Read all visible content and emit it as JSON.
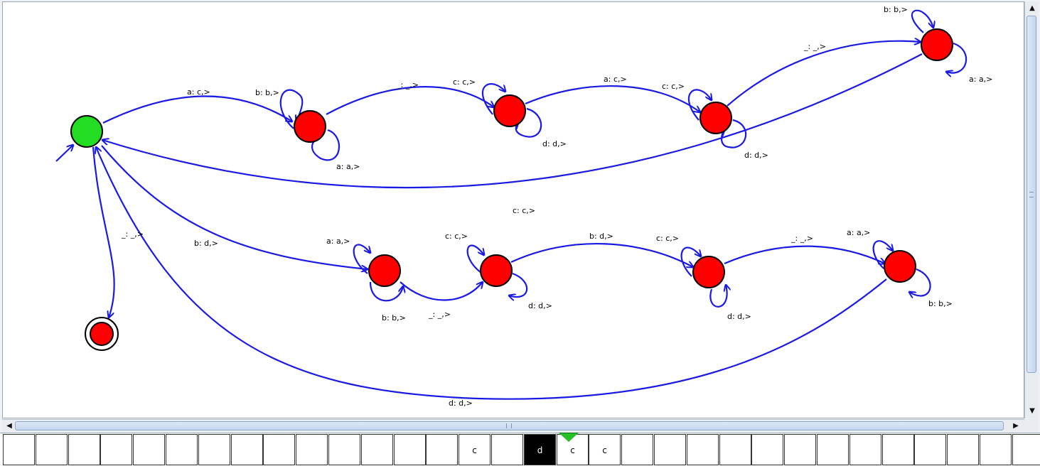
{
  "graph": {
    "edge_labels": [
      {
        "id": "e1",
        "text": "a: c,>"
      },
      {
        "id": "e2",
        "text": "b: b,>"
      },
      {
        "id": "e3",
        "text": "a: a,>"
      },
      {
        "id": "e4",
        "text": "_: _,>"
      },
      {
        "id": "e5",
        "text": "c: c,>"
      },
      {
        "id": "e6",
        "text": "d: d,>"
      },
      {
        "id": "e7",
        "text": "a: c,>"
      },
      {
        "id": "e8",
        "text": "c: c,>"
      },
      {
        "id": "e9",
        "text": "d: d,>"
      },
      {
        "id": "e10",
        "text": "_: _,>"
      },
      {
        "id": "e11",
        "text": "b: b,>"
      },
      {
        "id": "e12",
        "text": "a: a,>"
      },
      {
        "id": "e13",
        "text": "c: c,>"
      },
      {
        "id": "e14",
        "text": "_: _,>"
      },
      {
        "id": "e15",
        "text": "b: d,>"
      },
      {
        "id": "e16",
        "text": "a: a,>"
      },
      {
        "id": "e17",
        "text": "b: b,>"
      },
      {
        "id": "e18",
        "text": "_: _,>"
      },
      {
        "id": "e19",
        "text": "c: c,>"
      },
      {
        "id": "e20",
        "text": "d: d,>"
      },
      {
        "id": "e21",
        "text": "b: d,>"
      },
      {
        "id": "e22",
        "text": "c: c,>"
      },
      {
        "id": "e23",
        "text": "d: d,>"
      },
      {
        "id": "e24",
        "text": "_: _,>"
      },
      {
        "id": "e25",
        "text": "a: a,>"
      },
      {
        "id": "e26",
        "text": "b: b,>"
      },
      {
        "id": "e27",
        "text": "d: d,>"
      }
    ],
    "colors": {
      "edge": "#1a1ae6",
      "state": "#ff0000",
      "start_state": "#22dd22",
      "accept_state": "#ff0000",
      "tape_head": "#000000",
      "pointer": "#27c027"
    }
  },
  "tape": {
    "cells": [
      "",
      "",
      "",
      "",
      "",
      "",
      "",
      "",
      "",
      "",
      "",
      "",
      "",
      "",
      "c",
      "",
      "d",
      "c",
      "c",
      "",
      "",
      "",
      "",
      "",
      "",
      "",
      "",
      "",
      "",
      "",
      "",
      ""
    ],
    "head_index": 16,
    "pointer_index": 17
  },
  "scrollbars": {
    "up_icon": "▲",
    "down_icon": "▼",
    "left_icon": "◀",
    "right_icon": "▶"
  }
}
